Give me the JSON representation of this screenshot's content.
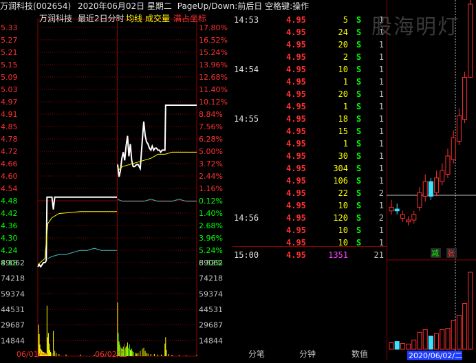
{
  "header": {
    "stock": "万润科技(002654)",
    "date": "2020年06月02日 星期二",
    "hint": "PageUp/Down:前后日 空格键:操作"
  },
  "chart_header": {
    "name": "万润科技",
    "range": "最近2日分时",
    "avg_label": "均线",
    "vol_label": "成交量",
    "full_label": "满占坐标"
  },
  "colors": {
    "up": "#ff3030",
    "down": "#00ff00",
    "price_line": "#ffffff",
    "avg_line": "#ffff00",
    "prev_day_line": "#40c0c0",
    "grid": "#8b0000",
    "volume": "#ffff00",
    "purple": "#ff40ff"
  },
  "chart_data": [
    {
      "type": "line",
      "title": "最近2日分时",
      "y_price_ticks": [
        "5.33",
        "5.27",
        "5.21",
        "5.15",
        "5.09",
        "5.03",
        "4.97",
        "4.91",
        "4.85",
        "4.78",
        "4.72",
        "4.66",
        "4.60",
        "4.54",
        "4.48",
        "4.42",
        "4.36",
        "4.30",
        "4.24",
        "4.18"
      ],
      "y_percent_ticks": [
        "17.80%",
        "16.52%",
        "15.24%",
        "13.96%",
        "12.68%",
        "11.40%",
        "10.12%",
        "8.84%",
        "7.56%",
        "6.28%",
        "5.00%",
        "3.72%",
        "2.44%",
        "1.16%",
        "0.12%",
        "1.40%",
        "2.68%",
        "3.96%",
        "5.24%",
        "6.52%"
      ],
      "pct_up_count": 14,
      "x_labels": [
        "06/01/一",
        "06/02/二"
      ],
      "ylim": [
        4.18,
        5.33
      ],
      "series": [
        {
          "day": "06/01",
          "price": [
            [
              0,
              4.16
            ],
            [
              2,
              4.17
            ],
            [
              4,
              4.16
            ],
            [
              6,
              4.17
            ],
            [
              8,
              4.18
            ],
            [
              10,
              4.18
            ],
            [
              12,
              4.19
            ],
            [
              13,
              4.5
            ],
            [
              14,
              4.5
            ],
            [
              16,
              4.5
            ],
            [
              20,
              4.5
            ],
            [
              22,
              4.44
            ],
            [
              24,
              4.5
            ],
            [
              40,
              4.5
            ],
            [
              80,
              4.5
            ],
            [
              112,
              4.5
            ]
          ],
          "avg": [
            [
              0,
              4.17
            ],
            [
              10,
              4.2
            ],
            [
              14,
              4.37
            ],
            [
              20,
              4.4
            ],
            [
              30,
              4.42
            ],
            [
              60,
              4.43
            ],
            [
              112,
              4.43
            ]
          ]
        },
        {
          "day": "06/02",
          "price": [
            [
              113,
              4.66
            ],
            [
              115,
              4.6
            ],
            [
              117,
              4.63
            ],
            [
              119,
              4.69
            ],
            [
              121,
              4.72
            ],
            [
              123,
              4.68
            ],
            [
              125,
              4.75
            ],
            [
              127,
              4.8
            ],
            [
              129,
              4.7
            ],
            [
              131,
              4.76
            ],
            [
              133,
              4.68
            ],
            [
              135,
              4.65
            ],
            [
              137,
              4.65
            ],
            [
              140,
              4.66
            ],
            [
              142,
              4.66
            ],
            [
              145,
              4.64
            ],
            [
              148,
              4.78
            ],
            [
              150,
              4.87
            ],
            [
              152,
              4.8
            ],
            [
              154,
              4.77
            ],
            [
              156,
              4.76
            ],
            [
              158,
              4.74
            ],
            [
              160,
              4.73
            ],
            [
              162,
              4.75
            ],
            [
              164,
              4.73
            ],
            [
              166,
              4.74
            ],
            [
              168,
              4.74
            ],
            [
              170,
              4.73
            ],
            [
              172,
              4.73
            ],
            [
              174,
              4.72
            ],
            [
              176,
              4.73
            ],
            [
              180,
              4.73
            ],
            [
              181,
              4.95
            ],
            [
              200,
              4.95
            ],
            [
              225,
              4.95
            ]
          ],
          "avg": [
            [
              113,
              4.63
            ],
            [
              120,
              4.65
            ],
            [
              130,
              4.66
            ],
            [
              140,
              4.67
            ],
            [
              150,
              4.68
            ],
            [
              160,
              4.69
            ],
            [
              170,
              4.71
            ],
            [
              180,
              4.71
            ],
            [
              190,
              4.72
            ],
            [
              225,
              4.72
            ]
          ]
        },
        {
          "day": "06/01-ref",
          "price": [
            [
              14,
              4.2
            ],
            [
              20,
              4.21
            ],
            [
              30,
              4.22
            ],
            [
              40,
              4.22
            ],
            [
              50,
              4.23
            ],
            [
              60,
              4.24
            ],
            [
              70,
              4.24
            ],
            [
              80,
              4.25
            ],
            [
              90,
              4.24
            ],
            [
              100,
              4.24
            ],
            [
              112,
              4.24
            ]
          ]
        },
        {
          "day": "06/02-ref",
          "price": [
            [
              113,
              4.49
            ],
            [
              120,
              4.48
            ],
            [
              130,
              4.48
            ],
            [
              140,
              4.48
            ],
            [
              150,
              4.48
            ],
            [
              160,
              4.49
            ],
            [
              170,
              4.48
            ],
            [
              180,
              4.48
            ],
            [
              190,
              4.48
            ],
            [
              200,
              4.49
            ],
            [
              210,
              4.48
            ],
            [
              225,
              4.48
            ]
          ]
        }
      ],
      "volume_ticks": [
        "89062",
        "74218",
        "59374",
        "44531",
        "29687",
        "14844"
      ],
      "volume_max": 89062,
      "volume": [
        [
          1,
          30000
        ],
        [
          2,
          21000
        ],
        [
          3,
          11000
        ],
        [
          4,
          7000
        ],
        [
          5,
          6000
        ],
        [
          6,
          5000
        ],
        [
          7,
          4000
        ],
        [
          8,
          4000
        ],
        [
          9,
          3500
        ],
        [
          10,
          3000
        ],
        [
          11,
          3000
        ],
        [
          12,
          2500
        ],
        [
          13,
          48000
        ],
        [
          14,
          18000
        ],
        [
          15,
          22000
        ],
        [
          16,
          12000
        ],
        [
          17,
          6000
        ],
        [
          18,
          4000
        ],
        [
          20,
          3000
        ],
        [
          22,
          24000
        ],
        [
          24,
          5000
        ],
        [
          26,
          3000
        ],
        [
          30,
          2000
        ],
        [
          40,
          1500
        ],
        [
          60,
          1500
        ],
        [
          80,
          1200
        ],
        [
          100,
          1000
        ],
        [
          112,
          1000
        ],
        [
          113,
          51000
        ],
        [
          114,
          22000
        ],
        [
          115,
          14000
        ],
        [
          116,
          11000
        ],
        [
          117,
          9000
        ],
        [
          118,
          8000
        ],
        [
          119,
          7000
        ],
        [
          120,
          6500
        ],
        [
          121,
          9000
        ],
        [
          122,
          6000
        ],
        [
          123,
          12000
        ],
        [
          124,
          8000
        ],
        [
          125,
          9000
        ],
        [
          126,
          10000
        ],
        [
          127,
          13000
        ],
        [
          128,
          8000
        ],
        [
          129,
          7000
        ],
        [
          130,
          11000
        ],
        [
          131,
          6000
        ],
        [
          132,
          5000
        ],
        [
          133,
          7000
        ],
        [
          134,
          5000
        ],
        [
          135,
          4000
        ],
        [
          138,
          3000
        ],
        [
          140,
          2500
        ],
        [
          142,
          3000
        ],
        [
          145,
          5000
        ],
        [
          148,
          7000
        ],
        [
          150,
          8000
        ],
        [
          152,
          5000
        ],
        [
          154,
          3000
        ],
        [
          156,
          2500
        ],
        [
          160,
          2000
        ],
        [
          165,
          2000
        ],
        [
          170,
          1500
        ],
        [
          175,
          1500
        ],
        [
          180,
          12000
        ],
        [
          181,
          18000
        ],
        [
          182,
          6000
        ],
        [
          185,
          2000
        ],
        [
          190,
          1200
        ],
        [
          200,
          1000
        ],
        [
          210,
          800
        ],
        [
          225,
          800
        ]
      ]
    },
    {
      "type": "bar",
      "title": "",
      "categories": [
        "K1",
        "K2",
        "K3",
        "K4",
        "K5",
        "K6",
        "K7",
        "K8",
        "K9",
        "K10",
        "K11",
        "K12",
        "K13",
        "K14",
        "K15"
      ],
      "open": [
        4.22,
        4.23,
        4.18,
        4.16,
        4.17,
        4.24,
        4.3,
        4.38,
        4.32,
        4.38,
        4.42,
        4.5,
        4.6,
        4.72,
        4.95
      ],
      "close": [
        4.24,
        4.22,
        4.2,
        4.17,
        4.2,
        4.32,
        4.38,
        4.3,
        4.4,
        4.44,
        4.52,
        4.62,
        4.74,
        4.95,
        5.35
      ],
      "high": [
        4.28,
        4.26,
        4.22,
        4.19,
        4.22,
        4.35,
        4.42,
        4.4,
        4.44,
        4.48,
        4.56,
        4.66,
        4.78,
        4.98,
        5.45
      ],
      "low": [
        4.2,
        4.2,
        4.16,
        4.14,
        4.15,
        4.22,
        4.27,
        4.28,
        4.3,
        4.36,
        4.4,
        4.48,
        4.58,
        4.7,
        4.95
      ],
      "volume": [
        10,
        12,
        9,
        8,
        14,
        26,
        30,
        20,
        24,
        30,
        32,
        44,
        52,
        70,
        118
      ],
      "date_label": "2020/06/02/二",
      "buttons": {
        "minus": "减",
        "plus": "张"
      }
    }
  ],
  "ticker": {
    "rows": [
      {
        "time": "14:53",
        "price": "4.95",
        "vol": "5",
        "side": "S",
        "cnt": "1"
      },
      {
        "time": "",
        "price": "4.95",
        "vol": "24",
        "side": "S",
        "cnt": "1"
      },
      {
        "time": "",
        "price": "4.95",
        "vol": "20",
        "side": "S",
        "cnt": "1"
      },
      {
        "time": "",
        "price": "4.95",
        "vol": "2",
        "side": "S",
        "cnt": "1"
      },
      {
        "time": "14:54",
        "price": "4.95",
        "vol": "10",
        "side": "S",
        "cnt": "1"
      },
      {
        "time": "",
        "price": "4.95",
        "vol": "1",
        "side": "S",
        "cnt": "1"
      },
      {
        "time": "",
        "price": "4.95",
        "vol": "20",
        "side": "S",
        "cnt": "1"
      },
      {
        "time": "",
        "price": "4.95",
        "vol": "1",
        "side": "S",
        "cnt": "1"
      },
      {
        "time": "14:55",
        "price": "4.95",
        "vol": "18",
        "side": "S",
        "cnt": "1"
      },
      {
        "time": "",
        "price": "4.95",
        "vol": "15",
        "side": "S",
        "cnt": "1"
      },
      {
        "time": "",
        "price": "4.95",
        "vol": "1",
        "side": "S",
        "cnt": "1"
      },
      {
        "time": "",
        "price": "4.95",
        "vol": "30",
        "side": "S",
        "cnt": "1"
      },
      {
        "time": "",
        "price": "4.95",
        "vol": "304",
        "side": "S",
        "cnt": "1"
      },
      {
        "time": "",
        "price": "4.95",
        "vol": "106",
        "side": "S",
        "cnt": "1"
      },
      {
        "time": "",
        "price": "4.95",
        "vol": "22",
        "side": "S",
        "cnt": "2"
      },
      {
        "time": "",
        "price": "4.95",
        "vol": "10",
        "side": "S",
        "cnt": "1"
      },
      {
        "time": "14:56",
        "price": "4.95",
        "vol": "120",
        "side": "S",
        "cnt": "2"
      },
      {
        "time": "",
        "price": "4.95",
        "vol": "10",
        "side": "S",
        "cnt": "1"
      },
      {
        "time": "",
        "price": "4.95",
        "vol": "10",
        "side": "S",
        "cnt": "1"
      },
      {
        "time": "15:00",
        "price": "4.95",
        "vol": "1351",
        "side": "",
        "cnt": "21"
      }
    ]
  },
  "tabs": [
    "分笔",
    "分钟",
    "数值"
  ],
  "watermark": "股海明灯"
}
